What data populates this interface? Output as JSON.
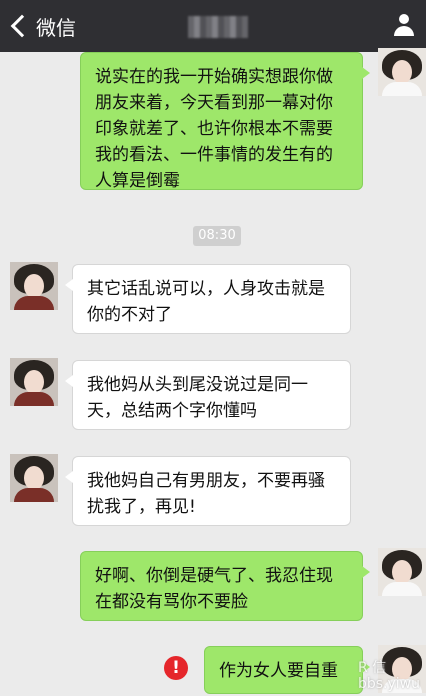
{
  "header": {
    "back_label": "微信",
    "contact_name_blurred": "",
    "profile_icon": "person-icon"
  },
  "messages": [
    {
      "side": "right",
      "text": "说实在的我一开始确实想跟你做朋友来着，今天看到那一幕对你印象就差了、也许你根本不需要我的看法、一件事情的发生有的人算是倒霉"
    },
    {
      "side": "left",
      "text": "其它话乱说可以，人身攻击就是你的不对了"
    },
    {
      "side": "left",
      "text": "我他妈从头到尾没说过是同一天，总结两个字你懂吗"
    },
    {
      "side": "left",
      "text": "我他妈自己有男朋友，不要再骚扰我了，再见!"
    },
    {
      "side": "right",
      "text": "好啊、你倒是硬气了、我忍住现在都没有骂你不要脸"
    },
    {
      "side": "right",
      "text": "作为女人要自重",
      "status": "failed"
    }
  ],
  "timestamp": "08:30",
  "failed_icon": "!",
  "watermark": "R 信\nbbs.yiwu"
}
